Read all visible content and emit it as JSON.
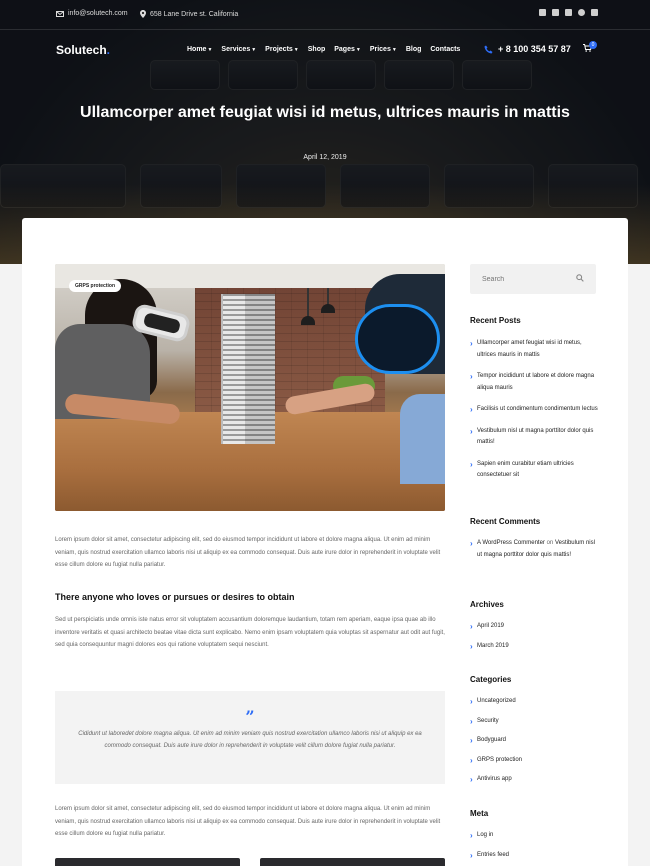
{
  "topbar": {
    "email": "info@solutech.com",
    "address": "658 Lane Drive st. California"
  },
  "nav": {
    "logo": "Solutech",
    "menu": [
      "Home",
      "Services",
      "Projects",
      "Shop",
      "Pages",
      "Prices",
      "Blog",
      "Contacts"
    ],
    "phone": "+ 8 100 354 57 87",
    "cart_count": "0"
  },
  "hero": {
    "title": "Ullamcorper amet feugiat wisi id metus, ultrices mauris in mattis",
    "date": "April 12, 2019"
  },
  "post": {
    "image_tag": "GRPS protection",
    "para1": "Lorem ipsum dolor sit amet, consectetur adipiscing elit, sed do eiusmod tempor incididunt ut labore et dolore magna aliqua. Ut enim ad minim veniam, quis nostrud exercitation ullamco laboris nisi ut aliquip ex ea commodo consequat. Duis aute irure dolor in reprehenderit in voluptate velit esse cillum dolore eu fugiat nulla pariatur.",
    "heading": "There anyone who loves or pursues or desires to obtain",
    "para2": "Sed ut perspiciatis unde omnis iste natus error sit voluptatem accusantium doloremque laudantium, totam rem aperiam, eaque ipsa quae ab illo inventore veritatis et quasi architecto beatae vitae dicta sunt explicabo. Nemo enim ipsam voluptatem quia voluptas sit aspernatur aut odit aut fugit, sed quia consequuntur magni dolores eos qui ratione voluptatem sequi nesciunt.",
    "quote": "Cididunt ut laboredet dolore magna aliqua. Ut enim ad minim veniam quis nostrud exercitation ullamco laboris nisi ut aliquip ex ea commodo consequat. Duis aute irure dolor in reprehenderit in voluptate velit cillum dolore fugiat nulla pariatur.",
    "para3": "Lorem ipsum dolor sit amet, consectetur adipiscing elit, sed do eiusmod tempor incididunt ut labore et dolore magna aliqua. Ut enim ad minim veniam, quis nostrud exercitation ullamco laboris nisi ut aliquip ex ea commodo consequat. Duis aute irure dolor in reprehenderit in voluptate velit esse cillum dolore eu fugiat nulla pariatur."
  },
  "sidebar": {
    "search_placeholder": "Search",
    "recent_posts_title": "Recent Posts",
    "recent_posts": [
      "Ullamcorper amet feugiat wisi id metus, ultrices mauris in mattis",
      "Tempor incididunt ut labore et dolore magna aliqua mauris",
      "Facilisis ut condimentum condimentum lectus",
      "Vestibulum nisl ut magna porttitor dolor quis mattis!",
      "Sapien enim curabitur etiam ultricies consectetuer sit"
    ],
    "recent_comments_title": "Recent Comments",
    "comment": {
      "author": "A WordPress Commenter",
      "on": "on",
      "post": "Vestibulum nisl ut magna porttitor dolor quis mattis!"
    },
    "archives_title": "Archives",
    "archives": [
      "April 2019",
      "March 2019"
    ],
    "categories_title": "Categories",
    "categories": [
      "Uncategorized",
      "Security",
      "Bodyguard",
      "GRPS protection",
      "Antivirus app"
    ],
    "meta_title": "Meta",
    "meta": [
      "Log in",
      "Entries feed"
    ]
  },
  "colors": {
    "accent": "#2d6cf6"
  }
}
